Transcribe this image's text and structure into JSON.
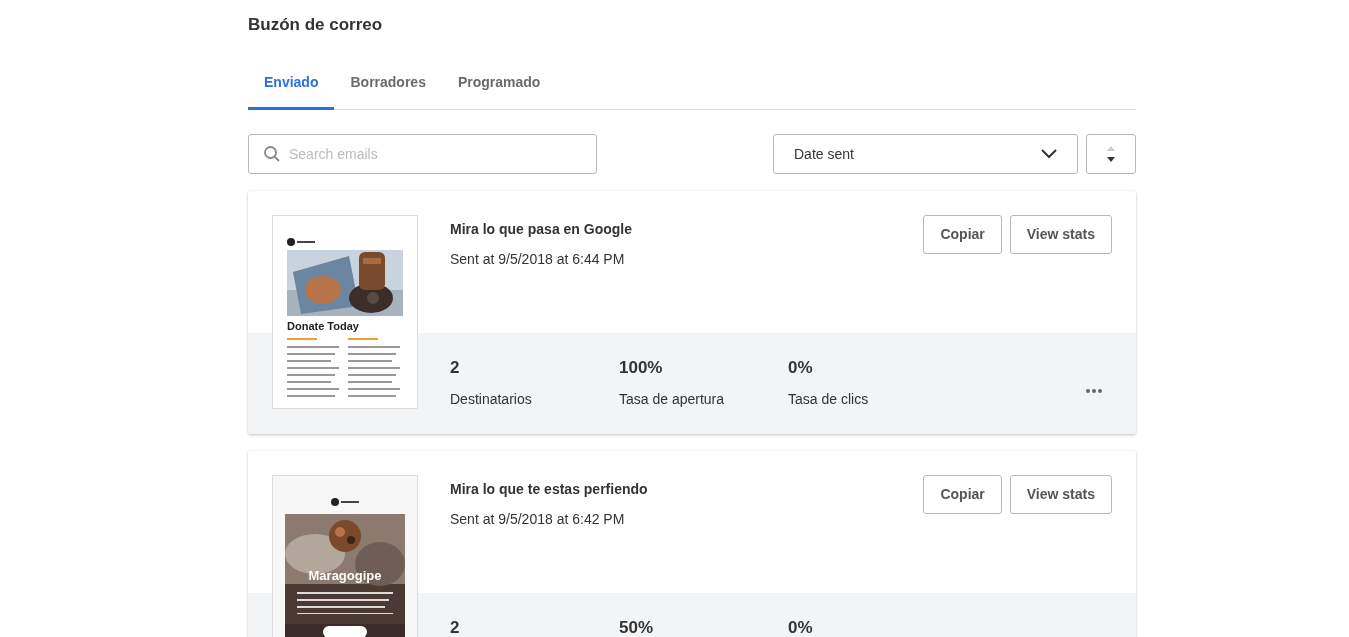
{
  "page_title": "Buzón de correo",
  "tabs": [
    {
      "label": "Enviado",
      "selected": true
    },
    {
      "label": "Borradores",
      "selected": false
    },
    {
      "label": "Programado",
      "selected": false
    }
  ],
  "search": {
    "placeholder": "Search emails"
  },
  "sort": {
    "value": "Date sent"
  },
  "emails": [
    {
      "title": "Mira lo que pasa en Google",
      "sent": "Sent at 9/5/2018 at 6:44 PM",
      "preview": {
        "kind": "donate",
        "heading": "Donate Today"
      },
      "buttons": [
        "Copiar",
        "View stats"
      ],
      "stats": [
        {
          "value": "2",
          "label": "Destinatarios"
        },
        {
          "value": "100%",
          "label": "Tasa de apertura"
        },
        {
          "value": "0%",
          "label": "Tasa de clics"
        }
      ],
      "more_menu": true
    },
    {
      "title": "Mira lo que te estas perfiendo",
      "sent": "Sent at 9/5/2018 at 6:42 PM",
      "preview": {
        "kind": "feature",
        "heading": "Maragogipe"
      },
      "buttons": [
        "Copiar",
        "View stats"
      ],
      "stats": [
        {
          "value": "2"
        },
        {
          "value": "50%"
        },
        {
          "value": "0%"
        }
      ]
    }
  ]
}
